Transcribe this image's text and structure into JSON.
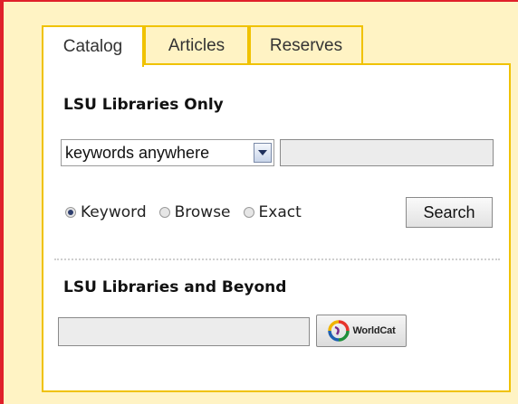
{
  "tabs": [
    {
      "label": "Catalog",
      "active": true
    },
    {
      "label": "Articles",
      "active": false
    },
    {
      "label": "Reserves",
      "active": false
    }
  ],
  "catalog_section": {
    "title": "LSU Libraries Only",
    "search_field_select": {
      "selected": "keywords anywhere"
    },
    "query_input": {
      "value": "",
      "placeholder": ""
    },
    "search_types": [
      {
        "label": "Keyword",
        "checked": true
      },
      {
        "label": "Browse",
        "checked": false
      },
      {
        "label": "Exact",
        "checked": false
      }
    ],
    "search_button_label": "Search"
  },
  "worldcat_section": {
    "title": "LSU Libraries and Beyond",
    "query_input": {
      "value": "",
      "placeholder": ""
    },
    "button_label": "WorldCat",
    "button_icon": "worldcat-logo-icon"
  },
  "colors": {
    "frame_background": "#fff3c4",
    "accent_border": "#e0202a",
    "tab_border": "#f0c200"
  }
}
